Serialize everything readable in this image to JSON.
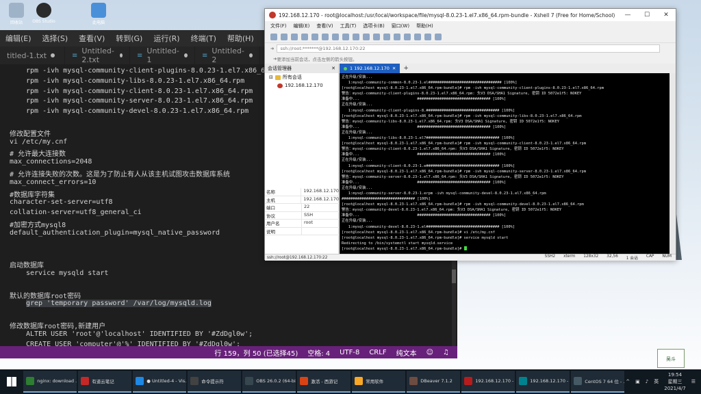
{
  "desktop": {
    "icons": [
      {
        "label": "回收站"
      },
      {
        "label": "OBS Studio"
      },
      {
        "label": "此电脑"
      }
    ]
  },
  "vscode": {
    "menu": [
      "编辑(E)",
      "选择(S)",
      "查看(V)",
      "转到(G)",
      "运行(R)",
      "终端(T)",
      "帮助(H)"
    ],
    "tabs": [
      "titled-1.txt",
      "Untitled-2.txt",
      "Untitled-1",
      "Untitled-2",
      "Un"
    ],
    "lines": [
      {
        "text": "rpm -ivh mysql-community-client-plugins-8.0.23-1.el7.x86_64",
        "indent": true
      },
      {
        "text": "rpm -ivh mysql-community-libs-8.0.23-1.el7.x86_64.rpm",
        "indent": true
      },
      {
        "text": "rpm -ivh mysql-community-client-8.0.23-1.el7.x86_64.rpm",
        "indent": true
      },
      {
        "text": "rpm -ivh mysql-community-server-8.0.23-1.el7.x86_64.rpm",
        "indent": true
      },
      {
        "text": "rpm -ivh mysql-community-devel-8.0.23-1.el7.x86_64.rpm",
        "indent": true
      },
      {
        "text": "",
        "indent": false
      },
      {
        "text": "修改配置文件",
        "indent": false
      },
      {
        "text": "vi /etc/my.cnf",
        "indent": false
      },
      {
        "text": "# 允许最大连接数",
        "indent": false
      },
      {
        "text": "max_connections=2048",
        "indent": false
      },
      {
        "text": "# 允许连接失败的次数。这是为了防止有人从该主机试图攻击数据库系统",
        "indent": false
      },
      {
        "text": "max_connect_errors=10",
        "indent": false
      },
      {
        "text": "#数据库字符集",
        "indent": false
      },
      {
        "text": "character-set-server=utf8",
        "indent": false
      },
      {
        "text": "collation-server=utf8_general_ci",
        "indent": false
      },
      {
        "text": "#加密方式mysql8",
        "indent": false
      },
      {
        "text": "default_authentication_plugin=mysql_native_password",
        "indent": false
      },
      {
        "text": "",
        "indent": false
      },
      {
        "text": "",
        "indent": false
      },
      {
        "text": "启动数据库",
        "indent": false
      },
      {
        "text": "service mysqld start",
        "indent": true
      },
      {
        "text": "",
        "indent": false
      },
      {
        "text": "默认的数据库root密码",
        "indent": false
      },
      {
        "text": "grep 'temporary password' /var/log/mysqld.log",
        "indent": true,
        "highlight": true
      },
      {
        "text": "",
        "indent": false
      },
      {
        "text": "修改数据库root密码,新建用户",
        "indent": false
      },
      {
        "text": "ALTER USER 'root'@'localhost' IDENTIFIED BY '#ZdDgl0w';",
        "indent": true
      },
      {
        "text": "CREATE USER 'computer'@'%' IDENTIFIED BY '#ZdDgl0w';",
        "indent": true
      }
    ],
    "status": {
      "position": "行 159，列 50 (已选择45)",
      "spaces": "空格: 4",
      "encoding": "UTF-8",
      "eol": "CRLF",
      "language": "纯文本"
    }
  },
  "xshell": {
    "title": "192.168.12.170 - root@localhost:/usr/local/workspace/file/mysql-8.0.23-1.el7.x86_64.rpm-bundle - Xshell 7 (Free for Home/School)",
    "menu": [
      "文件(F)",
      "编辑(E)",
      "查看(V)",
      "工具(T)",
      "选项卡(B)",
      "窗口(W)",
      "帮助(H)"
    ],
    "address": "ssh://root:*******@192.168.12.170:22",
    "hint": "要添加当前会话，点击左侧的箭头按钮。",
    "session_manager": {
      "title": "会话管理器",
      "root_node": "所有会话",
      "child_node": "192.168.12.170"
    },
    "properties": [
      {
        "key": "名称",
        "value": "192.168.12.170"
      },
      {
        "key": "主机",
        "value": "192.168.12.170"
      },
      {
        "key": "端口",
        "value": "22"
      },
      {
        "key": "协议",
        "value": "SSH"
      },
      {
        "key": "用户名",
        "value": "root"
      },
      {
        "key": "说明",
        "value": ""
      }
    ],
    "tab_label": "1 192.168.12.170",
    "terminal_lines": [
      "正在升级/安装...",
      "   1:mysql-community-common-8.0.23-1.el################################# [100%]",
      "[root@localhost mysql-8.0.23-1.el7.x86_64.rpm-bundle]# rpm -ivh mysql-community-client-plugins-8.0.23-1.el7.x86_64.rpm",
      "警告：mysql-community-client-plugins-8.0.23-1.el7.x86_64.rpm: 头V3 DSA/SHA1 Signature, 密钥 ID 5072e1f5: NOKEY",
      "准备中...                          ################################# [100%]",
      "正在升级/安装...",
      "   1:mysql-community-client-plugins-8.################################# [100%]",
      "[root@localhost mysql-8.0.23-1.el7.x86_64.rpm-bundle]# rpm -ivh mysql-community-libs-8.0.23-1.el7.x86_64.rpm",
      "警告：mysql-community-libs-8.0.23-1.el7.x86_64.rpm: 头V3 DSA/SHA1 Signature, 密钥 ID 5072e1f5: NOKEY",
      "准备中...                          ################################# [100%]",
      "正在升级/安装...",
      "   1:mysql-community-libs-8.0.23-1.el7################################# [100%]",
      "[root@localhost mysql-8.0.23-1.el7.x86_64.rpm-bundle]# rpm -ivh mysql-community-client-8.0.23-1.el7.x86_64.rpm",
      "警告：mysql-community-client-8.0.23-1.el7.x86_64.rpm: 头V3 DSA/SHA1 Signature, 密钥 ID 5072e1f5: NOKEY",
      "准备中...                          ################################# [100%]",
      "正在升级/安装...",
      "   1:mysql-community-client-8.0.23-1.e################################# [100%]",
      "[root@localhost mysql-8.0.23-1.el7.x86_64.rpm-bundle]# rpm -ivh mysql-community-server-8.0.23-1.el7.x86_64.rpm",
      "警告：mysql-community-server-8.0.23-1.el7.x86_64.rpm: 头V3 DSA/SHA1 Signature, 密钥 ID 5072e1f5: NOKEY",
      "准备中...                          ################################# [100%]",
      "正在升级/安装...",
      "   1:mysql-community-server-8.0.23-1.erpm -ivh mysql-community-devel-8.0.23-1.el7.x86_64.rpm",
      "################################# [100%]",
      "[root@localhost mysql-8.0.23-1.el7.x86_64.rpm-bundle]# rpm -ivh mysql-community-devel-8.0.23-1.el7.x86_64.rpm",
      "警告：mysql-community-devel-8.0.23-1.el7.x86_64.rpm: 头V3 DSA/SHA1 Signature, 密钥 ID 5072e1f5: NOKEY",
      "准备中...                          ################################# [100%]",
      "正在升级/安装...",
      "   1:mysql-community-devel-8.0.23-1.el################################# [100%]",
      "[root@localhost mysql-8.0.23-1.el7.x86_64.rpm-bundle]# vi /etc/my.cnf",
      "[root@localhost mysql-8.0.23-1.el7.x86_64.rpm-bundle]# service mysqld start",
      "Redirecting to /bin/systemctl start mysqld.service",
      "[root@localhost mysql-8.0.23-1.el7.x86_64.rpm-bundle]# "
    ],
    "statusbar": {
      "session": "ssh://root@192.168.12.170:22",
      "protocol": "SSH2",
      "term": "xterm",
      "size": "128x32",
      "pos": "32,56",
      "sessions": "1 会话",
      "caps": "CAP",
      "num": "NUM"
    }
  },
  "watermark": "吴斗",
  "taskbar": {
    "items": [
      {
        "label": "nginx: download ...",
        "color": "#2e7d32"
      },
      {
        "label": "有道云笔记",
        "color": "#c62828"
      },
      {
        "label": "● Untitled-4 - Vis...",
        "color": "#1e88e5"
      },
      {
        "label": "命令提示符",
        "color": "#424242"
      },
      {
        "label": "OBS 26.0.2 (64-bi...",
        "color": "#37474f"
      },
      {
        "label": "激活 - 西游记",
        "color": "#d84315"
      },
      {
        "label": "常用软件",
        "color": "#f9a825"
      },
      {
        "label": "DBeaver 7.1.2",
        "color": "#6d4c41"
      },
      {
        "label": "192.168.12.170 - ...",
        "color": "#b71c1c"
      },
      {
        "label": "192.168.12.170 - ...",
        "color": "#00838f"
      },
      {
        "label": "CentOS 7 64 位 - ...",
        "color": "#455a64"
      }
    ],
    "ime": "英",
    "time": "19:54",
    "weekday": "星期三",
    "date": "2021/4/7"
  },
  "colors": {
    "vscode_status": "#68217a",
    "xshell_tab": "#1e5fbf",
    "taskbar": "#101820"
  }
}
